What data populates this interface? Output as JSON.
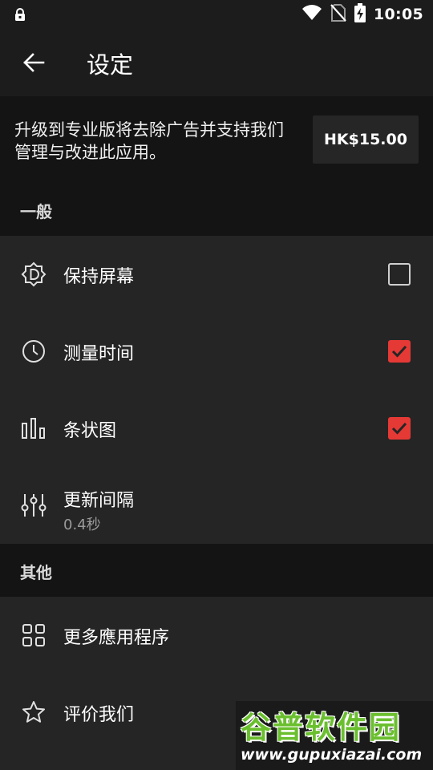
{
  "status_bar": {
    "time": "10:05",
    "icons": [
      "lock-icon",
      "wifi-icon",
      "no-sim-icon",
      "battery-charging-icon"
    ]
  },
  "app_bar": {
    "back_icon": "arrow-back-icon",
    "title": "设定"
  },
  "promo": {
    "text": "升级到专业版将去除广告并支持我们管理与改进此应用。",
    "price": "HK$15.00"
  },
  "sections": {
    "general": {
      "header": "一般",
      "items": [
        {
          "label": "保持屏幕",
          "icon": "brightness-auto-icon",
          "checked": false
        },
        {
          "label": "测量时间",
          "icon": "clock-icon",
          "checked": true
        },
        {
          "label": "条状图",
          "icon": "bar-chart-icon",
          "checked": true
        },
        {
          "label": "更新间隔",
          "sub": "0.4秒",
          "icon": "sliders-icon"
        }
      ]
    },
    "other": {
      "header": "其他",
      "items": [
        {
          "label": "更多應用程序",
          "icon": "apps-grid-icon"
        },
        {
          "label": "评价我们",
          "icon": "star-icon"
        }
      ]
    }
  },
  "watermark": {
    "brand": "谷普软件园",
    "url": "www.gupuxiazai.com"
  },
  "colors": {
    "accent": "#e53935",
    "background": "#1c1c1c",
    "row_background": "#252525",
    "header_background": "#141414"
  }
}
